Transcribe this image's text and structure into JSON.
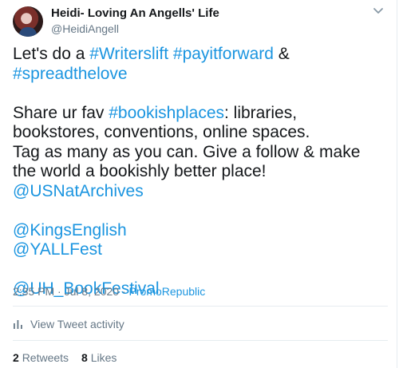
{
  "author": {
    "display_name": "Heidi- Loving An Angells' Life",
    "handle": "@HeidiAngell"
  },
  "tweet": {
    "line1": {
      "prefix": "Let's do a ",
      "tag1": "#Writerslift",
      "tag2": "#payitforward",
      "amp": " & ",
      "tag3": "#spreadthelove"
    },
    "line2": {
      "prefix": "Share ur fav ",
      "tag": "#bookishplaces",
      "suffix": ": libraries, bookstores, conventions, online spaces."
    },
    "line3": "Tag as many as you can. Give a follow & make the world a bookishly better place!",
    "mentions": [
      "@USNatArchives",
      "@KingsEnglish",
      "@YALLFest",
      "@UH_BookFestival"
    ]
  },
  "meta": {
    "timestamp": "2:35 PM · Jul 8, 2020",
    "separator": " · ",
    "source": "PromoRepublic"
  },
  "activity": {
    "label": "View Tweet activity",
    "icon": "bar-chart-icon"
  },
  "stats": {
    "retweets_count": "2",
    "retweets_label": "Retweets",
    "likes_count": "8",
    "likes_label": "Likes"
  },
  "colors": {
    "link": "#1b95e0",
    "text": "#14171a",
    "muted": "#657786",
    "divider": "#e6ecf0"
  }
}
